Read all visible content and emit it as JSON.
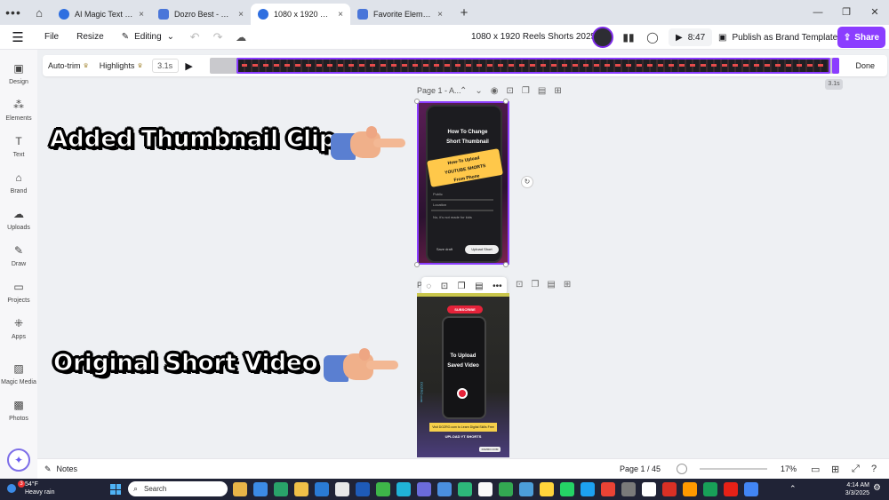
{
  "browser": {
    "tabs": [
      {
        "label": "AI Magic Text Gene...",
        "color": "#2f6fe0",
        "active": false
      },
      {
        "label": "Dozro Best - YouTu...",
        "color": "#4a76d9",
        "active": false
      },
      {
        "label": "1080 x 1920 Reels ...",
        "color": "#2f6fe0",
        "active": true
      },
      {
        "label": "Favorite Elements ...",
        "color": "#4a76d9",
        "active": false
      }
    ],
    "close_glyph": "×",
    "new_tab": "+"
  },
  "toolbar": {
    "file": "File",
    "resize": "Resize",
    "editing": "Editing",
    "doc_title": "1080 x 1920 Reels Shorts 2025",
    "duration": "8:47",
    "brand_template": "Publish as Brand Template",
    "share": "Share"
  },
  "timeline": {
    "auto_trim": "Auto-trim",
    "highlights": "Highlights",
    "clip_duration": "3.1s",
    "done": "Done",
    "tooltip": "3.1s"
  },
  "sidebar": {
    "items": [
      {
        "label": "Design",
        "icon": "▣"
      },
      {
        "label": "Elements",
        "icon": "⁂"
      },
      {
        "label": "Text",
        "icon": "T"
      },
      {
        "label": "Brand",
        "icon": "⌂"
      },
      {
        "label": "Uploads",
        "icon": "☁"
      },
      {
        "label": "Draw",
        "icon": "✎"
      },
      {
        "label": "Projects",
        "icon": "▭"
      },
      {
        "label": "Apps",
        "icon": "⁜"
      },
      {
        "label": "Magic Media",
        "icon": "▨"
      },
      {
        "label": "Photos",
        "icon": "▩"
      }
    ]
  },
  "canvas": {
    "caption_top": "Added Thumbnail Clip",
    "caption_bottom": "Original Short Video",
    "page1_label": "Page 1 - A...",
    "page2_label": "P",
    "page1": {
      "title_line1": "How To Change",
      "title_line2": "Short Thumbnail",
      "badge_line1": "How-To Upload",
      "badge_line2": "YOUTUBE SHORTS",
      "badge_line3": "From Phone",
      "row1": "Public",
      "row2": "Location",
      "row3": "No, it's not made for kids",
      "btn_left": "Save draft",
      "btn_right": "Upload Short"
    },
    "page2": {
      "subscribe": "SUBSCRIBE",
      "title_line1": "To Upload",
      "title_line2": "Saved Video",
      "banner": "Visit DOZRO.com to Learn Digital Skills Free",
      "upload_line": "UPLOAD YT SHORTS",
      "domain": "DOZRO.COM",
      "side_text": "DOZRO.com"
    }
  },
  "bottombar": {
    "notes": "Notes",
    "page_info": "Page 1 / 45",
    "zoom": "17%"
  },
  "taskbar": {
    "temp": "54°F",
    "weather": "Heavy rain",
    "badge": "3",
    "search": "Search",
    "time": "4:14 AM",
    "date": "3/3/2025",
    "app_colors": [
      "#e8b448",
      "#3c8be6",
      "#29a36a",
      "#f0c048",
      "#2a7bd5",
      "#e8e8e8",
      "#1e5bb8",
      "#3eb549",
      "#20b3d8",
      "#6b6bdb",
      "#4a8fe0",
      "#2db87a",
      "#f9f9f9",
      "#33a852",
      "#4c9ed9",
      "#ffd43b",
      "#25d366",
      "#1da1f2",
      "#ea4335",
      "#7a7a7a",
      "#ffffff",
      "#d93025",
      "#ff9900",
      "#18a058",
      "#e62117",
      "#4285f4"
    ]
  }
}
